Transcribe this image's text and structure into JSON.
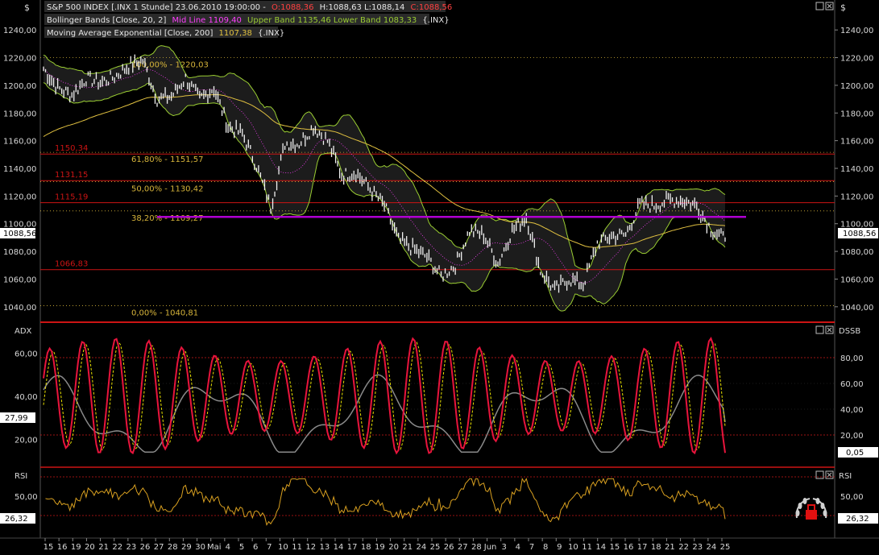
{
  "colors": {
    "background": "#000000",
    "axis_text": "#d8d8d8",
    "fib": "#d6b43a",
    "level": "#cc1414",
    "price": "#f2f2f2",
    "boll_band": "#9acd32",
    "boll_mid": "#ff3eff",
    "ema": "#e0c040",
    "adx": "#8a8a8a",
    "dss": "#e8143c",
    "dss_signal": "#e8e000",
    "rsi": "#d9a020",
    "marker": "#b000d0",
    "current_label": "#ff3030"
  },
  "header": {
    "currency_symbol": "$",
    "title_main": "S&P 500 INDEX [.INX 1 Stunde] 23.06.2010 19:00:00 -",
    "ohlc_open": "O:1088,36",
    "ohlc_hl": "H:1088,63 L:1088,14",
    "ohlc_close": "C:1088,56",
    "bollinger_prefix": "Bollinger Bands [Close, 20, 2]",
    "bollinger_mid": "Mid Line 1109,40",
    "bollinger_bands": "Upper Band 1135,46 Lower Band 1083,33",
    "bollinger_suffix": "{.INX}",
    "ema_prefix": "Moving Average Exponential [Close, 200]",
    "ema_value": "1107,38",
    "ema_suffix": "{.INX}"
  },
  "axis": {
    "price_ticks": [
      "1240,00",
      "1220,00",
      "1200,00",
      "1180,00",
      "1160,00",
      "1140,00",
      "1120,00",
      "1100,00",
      "1080,00",
      "1060,00",
      "1040,00"
    ],
    "current_price_label": "1088,56",
    "adx_label": "ADX",
    "dssb_label": "DSSB",
    "adx_ticks": [
      "60,00",
      "40,00",
      "20,00"
    ],
    "dss_ticks": [
      "80,00",
      "60,00",
      "40,00",
      "20,00"
    ],
    "adx_current": "27,99",
    "dss_current": "0,05",
    "rsi_label": "RSI",
    "rsi_ticks": [
      "50,00"
    ],
    "rsi_current": "26,32",
    "date_labels": [
      "15",
      "16",
      "19",
      "20",
      "21",
      "22",
      "23",
      "26",
      "27",
      "28",
      "29",
      "30",
      "Mai",
      "4",
      "5",
      "6",
      "7",
      "10",
      "11",
      "12",
      "13",
      "14",
      "17",
      "18",
      "19",
      "20",
      "21",
      "24",
      "25",
      "26",
      "27",
      "28",
      "Jun",
      "3",
      "4",
      "7",
      "8",
      "9",
      "10",
      "11",
      "14",
      "15",
      "16",
      "17",
      "18",
      "21",
      "22",
      "23",
      "24",
      "25"
    ]
  },
  "fibonacci": [
    {
      "label": "100,00% - 1220,03",
      "value": 1220.03
    },
    {
      "label": "61,80% - 1151,57",
      "value": 1151.57
    },
    {
      "label": "50,00% - 1130,42",
      "value": 1130.42
    },
    {
      "label": "38,20% - 1109,27",
      "value": 1109.27
    },
    {
      "label": "0,00% - 1040,81",
      "value": 1040.81
    }
  ],
  "levels": [
    {
      "label": "1150,34",
      "value": 1150.34
    },
    {
      "label": "1131,15",
      "value": 1131.15
    },
    {
      "label": "1115,19",
      "value": 1115.19
    },
    {
      "label": "1066,83",
      "value": 1066.83
    }
  ],
  "chart_data": {
    "type": "line",
    "title": "S&P 500 INDEX [.INX 1 Stunde]",
    "ylim": [
      1030,
      1250
    ],
    "price_path": [
      [
        "2010-04-15",
        1212
      ],
      [
        "2010-04-16",
        1198
      ],
      [
        "2010-04-19",
        1193
      ],
      [
        "2010-04-20",
        1205
      ],
      [
        "2010-04-21",
        1202
      ],
      [
        "2010-04-22",
        1206
      ],
      [
        "2010-04-23",
        1214
      ],
      [
        "2010-04-26",
        1218
      ],
      [
        "2010-04-27",
        1190
      ],
      [
        "2010-04-28",
        1192
      ],
      [
        "2010-04-29",
        1205
      ],
      [
        "2010-04-30",
        1190
      ],
      [
        "2010-05-03",
        1198
      ],
      [
        "2010-05-04",
        1170
      ],
      [
        "2010-05-05",
        1165
      ],
      [
        "2010-05-06",
        1142
      ],
      [
        "2010-05-07",
        1112
      ],
      [
        "2010-05-10",
        1158
      ],
      [
        "2010-05-11",
        1158
      ],
      [
        "2010-05-12",
        1170
      ],
      [
        "2010-05-13",
        1160
      ],
      [
        "2010-05-14",
        1135
      ],
      [
        "2010-05-17",
        1137
      ],
      [
        "2010-05-18",
        1125
      ],
      [
        "2010-05-19",
        1113
      ],
      [
        "2010-05-20",
        1088
      ],
      [
        "2010-05-21",
        1082
      ],
      [
        "2010-05-24",
        1076
      ],
      [
        "2010-05-25",
        1062
      ],
      [
        "2010-05-26",
        1070
      ],
      [
        "2010-05-27",
        1095
      ],
      [
        "2010-05-28",
        1092
      ],
      [
        "2010-06-01",
        1071
      ],
      [
        "2010-06-02",
        1095
      ],
      [
        "2010-06-03",
        1105
      ],
      [
        "2010-06-04",
        1066
      ],
      [
        "2010-06-07",
        1052
      ],
      [
        "2010-06-08",
        1060
      ],
      [
        "2010-06-09",
        1056
      ],
      [
        "2010-06-10",
        1086
      ],
      [
        "2010-06-11",
        1091
      ],
      [
        "2010-06-14",
        1092
      ],
      [
        "2010-06-15",
        1114
      ],
      [
        "2010-06-16",
        1113
      ],
      [
        "2010-06-17",
        1117
      ],
      [
        "2010-06-18",
        1117
      ],
      [
        "2010-06-21",
        1113
      ],
      [
        "2010-06-22",
        1096
      ],
      [
        "2010-06-23",
        1088.56
      ]
    ],
    "indicators": {
      "bollinger": {
        "period": 20,
        "stddev": 2,
        "mid": 1109.4,
        "upper": 1135.46,
        "lower": 1083.33
      },
      "ema200": 1107.38,
      "adx_last": 27.99,
      "dss_last": 0.05,
      "rsi_last": 26.32
    },
    "adx_ylim": [
      10,
      70
    ],
    "dss_ylim": [
      0,
      100
    ],
    "rsi_ylim": [
      10,
      70
    ]
  }
}
